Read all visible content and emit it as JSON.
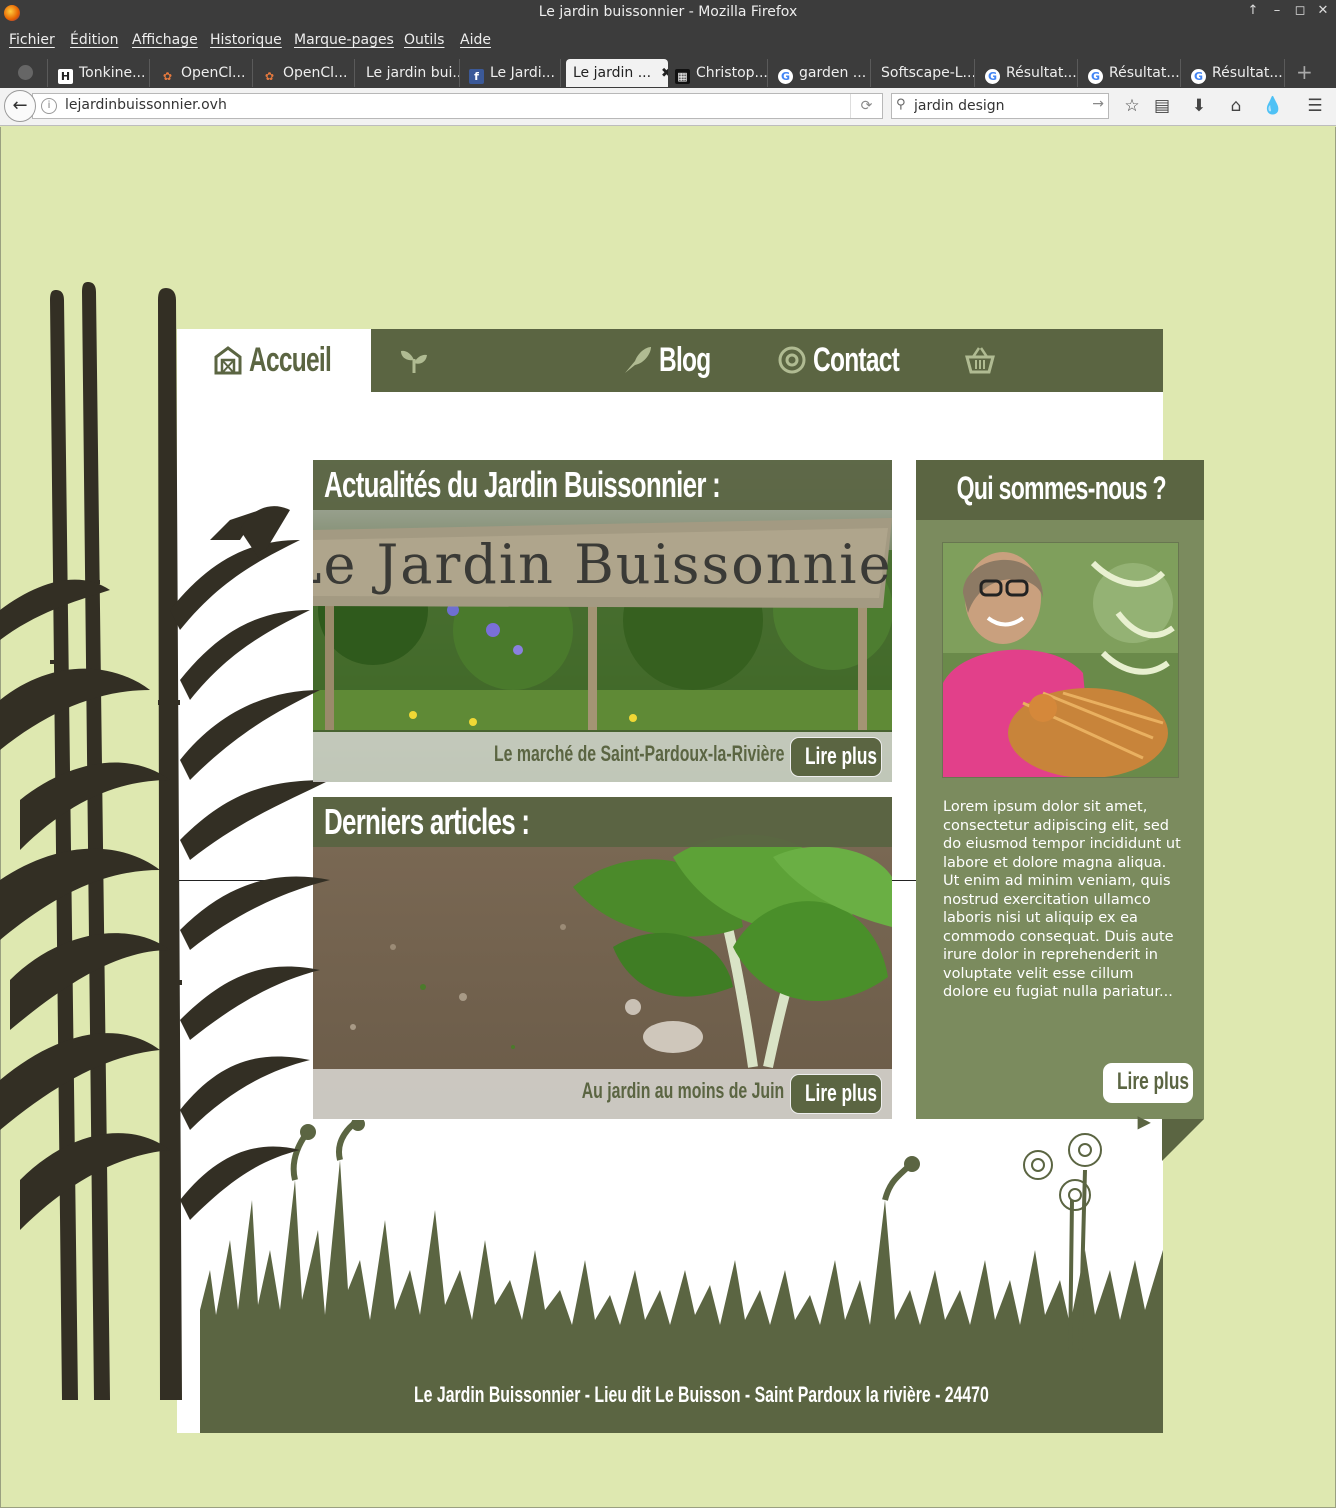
{
  "window": {
    "title": "Le jardin buissonnier - Mozilla Firefox"
  },
  "menu": [
    "Fichier",
    "Édition",
    "Affichage",
    "Historique",
    "Marque-pages",
    "Outils",
    "Aide"
  ],
  "tabs": [
    {
      "label": "Tonkine...",
      "icon": "h-icon"
    },
    {
      "label": "OpenCl...",
      "icon": "openclassrooms-icon"
    },
    {
      "label": "OpenCl...",
      "icon": "openclassrooms-icon"
    },
    {
      "label": "Le jardin bui...",
      "icon": "none"
    },
    {
      "label": "Le Jardi...",
      "icon": "facebook-icon"
    },
    {
      "label": "Le jardin ...",
      "icon": "none",
      "active": true
    },
    {
      "label": "Christop...",
      "icon": "dribbble-icon"
    },
    {
      "label": "garden ...",
      "icon": "google-icon"
    },
    {
      "label": "Softscape-L...",
      "icon": "none"
    },
    {
      "label": "Résultat...",
      "icon": "google-icon"
    },
    {
      "label": "Résultat...",
      "icon": "google-icon"
    },
    {
      "label": "Résultat...",
      "icon": "google-icon"
    }
  ],
  "address": {
    "url": "lejardinbuissonnier.ovh"
  },
  "search": {
    "value": "jardin design"
  },
  "site": {
    "nav": [
      {
        "label": "Accueil",
        "icon": "barn-icon"
      },
      {
        "label": "Aux jardins",
        "icon": "sprout-icon"
      },
      {
        "label": "Blog",
        "icon": "quill-icon"
      },
      {
        "label": "Contact",
        "icon": "at-icon"
      },
      {
        "label": "Mon Panier",
        "icon": "basket-icon"
      }
    ],
    "news": {
      "title": "Actualités du Jardin Buissonnier :",
      "sign_text": "Le Jardin Buissonnier",
      "caption": "Le marché de Saint-Pardoux-la-Rivière",
      "button": "Lire plus"
    },
    "articles": {
      "title": "Derniers articles :",
      "caption": "Au jardin au moins de Juin",
      "button": "Lire plus"
    },
    "about": {
      "title": "Qui sommes-nous ?",
      "text": "Lorem ipsum dolor sit amet, consectetur adipiscing elit, sed do eiusmod tempor incididunt ut labore et dolore magna aliqua. Ut enim ad minim veniam, quis nostrud exercitation ullamco laboris nisi ut aliquip ex ea commodo consequat. Duis aute irure dolor in reprehenderit in voluptate velit esse cillum dolore eu fugiat nulla pariatur...",
      "button": "Lire plus"
    },
    "footer": "Le Jardin Buissonnier - Lieu dit Le Buisson - Saint Pardoux la rivière - 24470"
  },
  "colors": {
    "page_bg": "#dee8b0",
    "dark_green": "#5b6542",
    "mid_green": "#7b8b5e",
    "bamboo": "#332f24"
  }
}
